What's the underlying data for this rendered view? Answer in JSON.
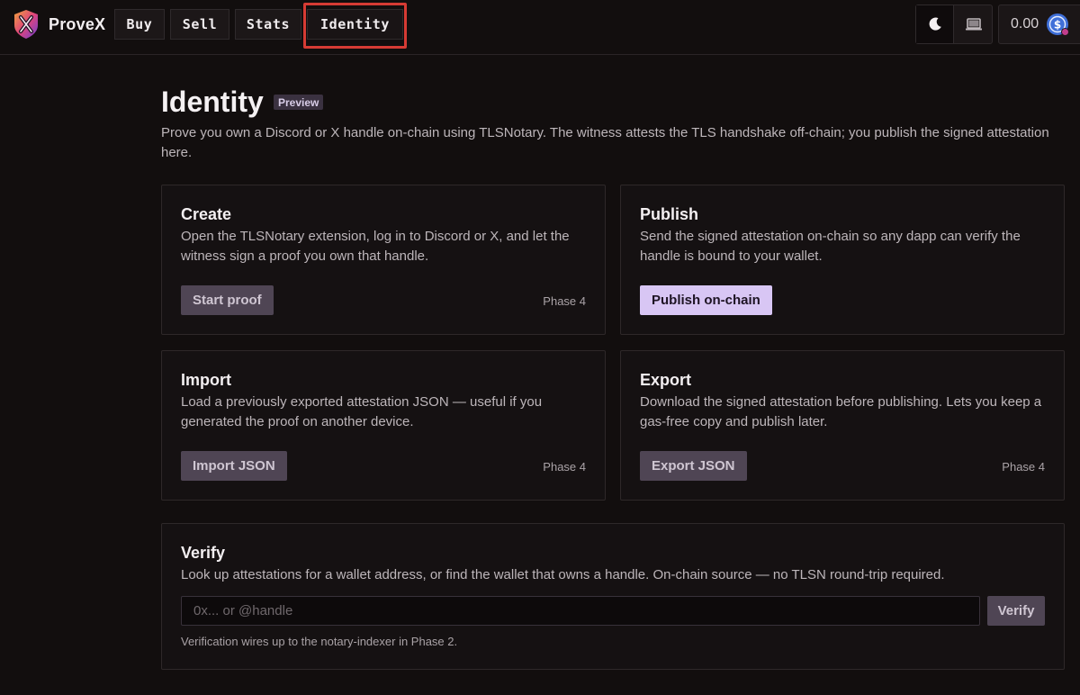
{
  "app": {
    "name": "ProveX"
  },
  "nav": {
    "items": [
      {
        "label": "Buy"
      },
      {
        "label": "Sell"
      },
      {
        "label": "Stats"
      },
      {
        "label": "Identity",
        "active": true
      }
    ]
  },
  "toolbar": {
    "theme_icon": "moon-icon",
    "device_icon": "laptop-icon",
    "balance": "0.00",
    "coin_icon": "coin-icon"
  },
  "page": {
    "title": "Identity",
    "badge": "Preview",
    "description": "Prove you own a Discord or X handle on-chain using TLSNotary. The witness attests the TLS handshake off-chain; you publish the signed attestation here."
  },
  "cards": {
    "create": {
      "title": "Create",
      "description": "Open the TLSNotary extension, log in to Discord or X, and let the witness sign a proof you own that handle.",
      "button": "Start proof",
      "phase": "Phase 4"
    },
    "publish": {
      "title": "Publish",
      "description": "Send the signed attestation on-chain so any dapp can verify the handle is bound to your wallet.",
      "button": "Publish on-chain"
    },
    "import": {
      "title": "Import",
      "description": "Load a previously exported attestation JSON — useful if you generated the proof on another device.",
      "button": "Import JSON",
      "phase": "Phase 4"
    },
    "export": {
      "title": "Export",
      "description": "Download the signed attestation before publishing. Lets you keep a gas-free copy and publish later.",
      "button": "Export JSON",
      "phase": "Phase 4"
    },
    "verify": {
      "title": "Verify",
      "description": "Look up attestations for a wallet address, or find the wallet that owns a handle. On-chain source — no TLSN round-trip required.",
      "input_value": "",
      "input_placeholder": "0x... or @handle",
      "button": "Verify",
      "note": "Verification wires up to the notary-indexer in Phase 2."
    }
  },
  "colors": {
    "background": "#120e0e",
    "primary_button": "#d8c6f4",
    "muted_button": "#4f4554",
    "active_nav_highlight": "#d63b34"
  }
}
